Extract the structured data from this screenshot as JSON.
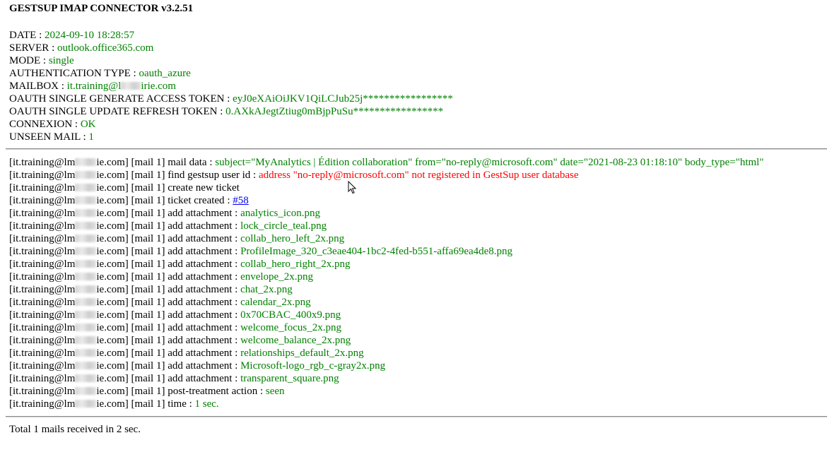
{
  "title": "GESTSUP IMAP CONNECTOR v3.2.51",
  "info": [
    {
      "label": "DATE",
      "value": "2024-09-10 18:28:57"
    },
    {
      "label": "SERVER",
      "value": "outlook.office365.com"
    },
    {
      "label": "MODE",
      "value": "single"
    },
    {
      "label": "AUTHENTICATION TYPE",
      "value": "oauth_azure"
    },
    {
      "label": "MAILBOX",
      "value_pre": "it.training@l",
      "value_post": "irie.com"
    },
    {
      "label": "OAUTH SINGLE GENERATE ACCESS TOKEN",
      "value": "eyJ0eXAiOiJKV1QiLCJub25j*****************"
    },
    {
      "label": "OAUTH SINGLE UPDATE REFRESH TOKEN",
      "value": "0.AXkAJegtZtiug0mBjpPuSu*****************"
    },
    {
      "label": "CONNEXION",
      "value": "OK"
    },
    {
      "label": "UNSEEN MAIL",
      "value": "1"
    }
  ],
  "log": {
    "prefix_start": "[it.training@lm",
    "prefix_end": "ie.com] [mail 1] ",
    "separator": " : ",
    "lines": [
      {
        "action": "mail data",
        "value": "subject=\"MyAnalytics | Édition collaboration\" from=\"no-reply@microsoft.com\" date=\"2021-08-23 01:18:10\" body_type=\"html\"",
        "color": "green"
      },
      {
        "action": "find gestsup user id",
        "value": "address \"no-reply@microsoft.com\" not registered in GestSup user database",
        "color": "red"
      },
      {
        "action": "create new ticket"
      },
      {
        "action": "ticket created",
        "link": "#58"
      },
      {
        "action": "add attachment",
        "value": "analytics_icon.png",
        "color": "green"
      },
      {
        "action": "add attachment",
        "value": "lock_circle_teal.png",
        "color": "green"
      },
      {
        "action": "add attachment",
        "value": "collab_hero_left_2x.png",
        "color": "green"
      },
      {
        "action": "add attachment",
        "value": "ProfileImage_320_c3eae404-1bc2-4fed-b551-affa69ea4de8.png",
        "color": "green"
      },
      {
        "action": "add attachment",
        "value": "collab_hero_right_2x.png",
        "color": "green"
      },
      {
        "action": "add attachment",
        "value": "envelope_2x.png",
        "color": "green"
      },
      {
        "action": "add attachment",
        "value": "chat_2x.png",
        "color": "green"
      },
      {
        "action": "add attachment",
        "value": "calendar_2x.png",
        "color": "green"
      },
      {
        "action": "add attachment",
        "value": "0x70CBAC_400x9.png",
        "color": "green"
      },
      {
        "action": "add attachment",
        "value": "welcome_focus_2x.png",
        "color": "green"
      },
      {
        "action": "add attachment",
        "value": "welcome_balance_2x.png",
        "color": "green"
      },
      {
        "action": "add attachment",
        "value": "relationships_default_2x.png",
        "color": "green"
      },
      {
        "action": "add attachment",
        "value": "Microsoft-logo_rgb_c-gray2x.png",
        "color": "green"
      },
      {
        "action": "add attachment",
        "value": "transparent_square.png",
        "color": "green"
      },
      {
        "action": "post-treatment action",
        "value": "seen",
        "color": "green"
      },
      {
        "action": "time",
        "value": "1 sec.",
        "color": "green"
      }
    ]
  },
  "footer": "Total 1 mails received in 2 sec.",
  "colors": {
    "value_green": "#008000",
    "error_red": "#ff0000",
    "link_blue": "#0000ee"
  }
}
